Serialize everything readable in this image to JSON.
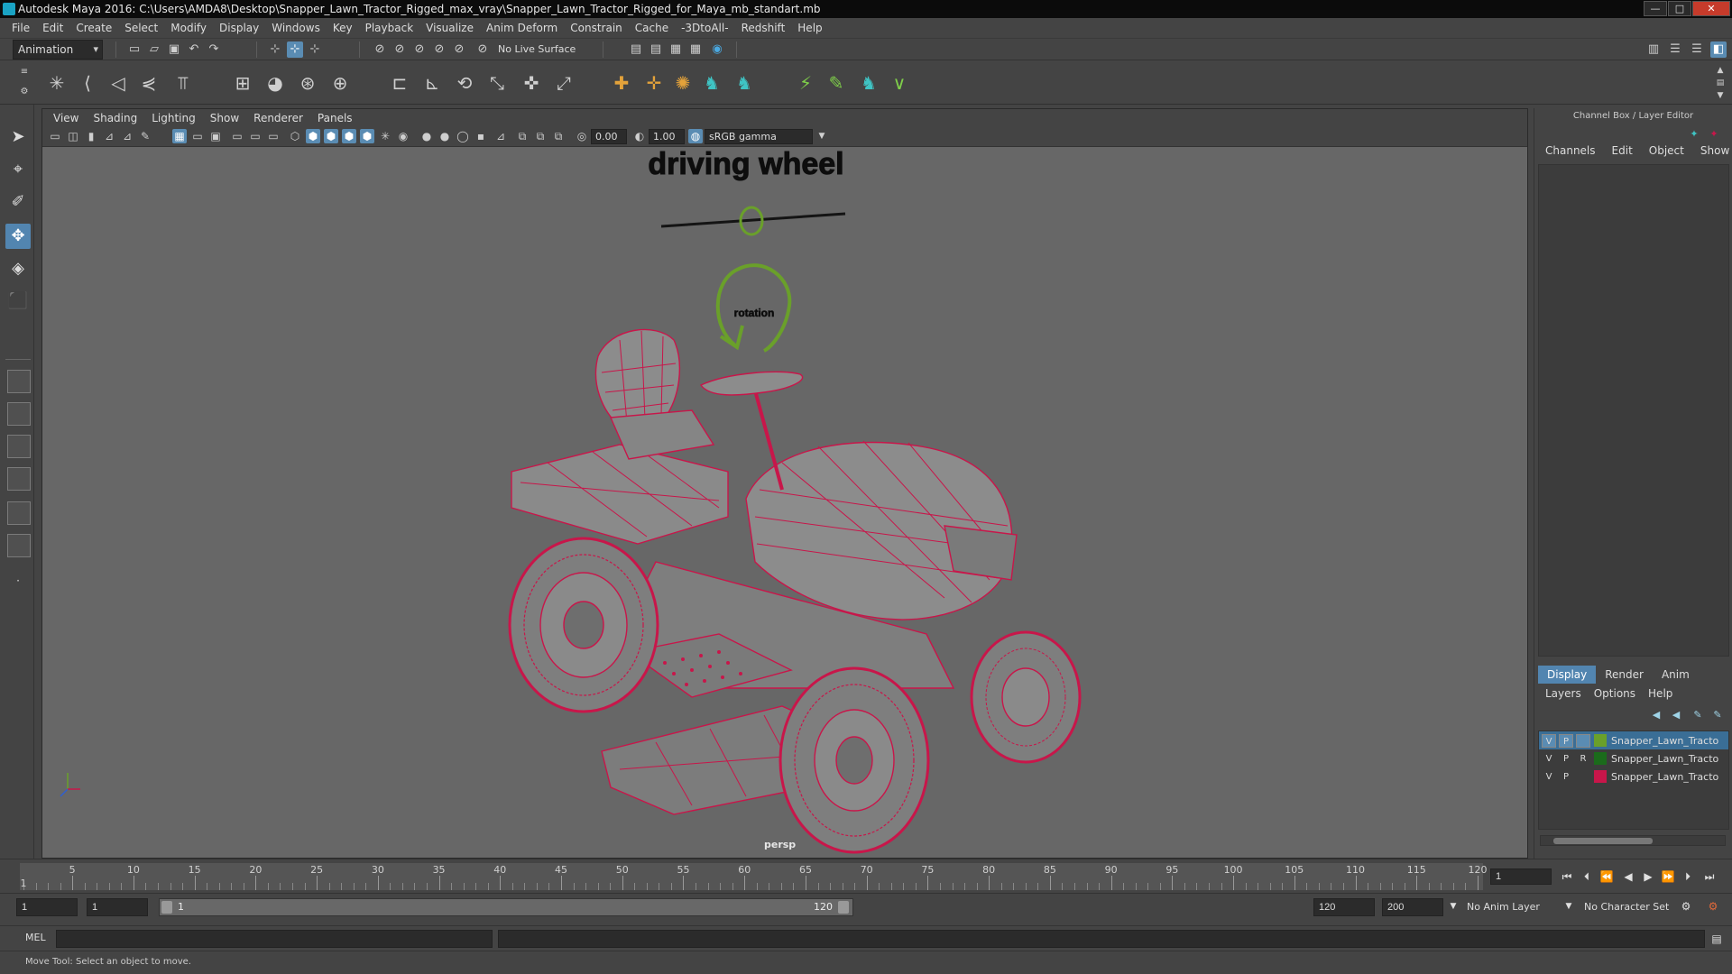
{
  "window": {
    "title": "Autodesk Maya 2016: C:\\Users\\AMDA8\\Desktop\\Snapper_Lawn_Tractor_Rigged_max_vray\\Snapper_Lawn_Tractor_Rigged_for_Maya_mb_standart.mb",
    "buttons": {
      "minimize": "—",
      "maximize": "□",
      "close": "✕"
    }
  },
  "menubar": [
    "File",
    "Edit",
    "Create",
    "Select",
    "Modify",
    "Display",
    "Windows",
    "Key",
    "Playback",
    "Visualize",
    "Anim Deform",
    "Constrain",
    "Cache",
    "-3DtoAll-",
    "Redshift",
    "Help"
  ],
  "statusline": {
    "mode": "Animation",
    "live_surface": "No Live Surface"
  },
  "viewport": {
    "menu": [
      "View",
      "Shading",
      "Lighting",
      "Show",
      "Renderer",
      "Panels"
    ],
    "exposure": "0.00",
    "gamma": "1.00",
    "color_space": "sRGB gamma",
    "camera": "persp",
    "controls": {
      "wheel_label": "driving wheel",
      "rotation_label": "rotation"
    },
    "wire_color": "#c8164a",
    "control_color": "#6aa02a"
  },
  "channel_box": {
    "title": "Channel Box / Layer Editor",
    "menu": [
      "Channels",
      "Edit",
      "Object",
      "Show"
    ],
    "layer_tabs": [
      "Display",
      "Render",
      "Anim"
    ],
    "active_tab": "Display",
    "layer_menu": [
      "Layers",
      "Options",
      "Help"
    ],
    "layers": [
      {
        "v": "V",
        "p": "P",
        "r": "",
        "color": "#6aa02a",
        "name": "Snapper_Lawn_Tractor",
        "selected": true
      },
      {
        "v": "V",
        "p": "P",
        "r": "R",
        "color": "#1b6b1b",
        "name": "Snapper_Lawn_Tractor",
        "selected": false
      },
      {
        "v": "V",
        "p": "P",
        "r": "",
        "color": "#c8164a",
        "name": "Snapper_Lawn_Tractor",
        "selected": false
      }
    ]
  },
  "timeline": {
    "start": 1,
    "end": 120,
    "ticks": [
      5,
      10,
      15,
      20,
      25,
      30,
      35,
      40,
      45,
      50,
      55,
      60,
      65,
      70,
      75,
      80,
      85,
      90,
      95,
      100,
      105,
      110,
      115,
      120
    ],
    "first_label": "1",
    "current_frame": "1"
  },
  "range": {
    "start_time": "1",
    "playback_start": "1",
    "range_start_label": "1",
    "range_end_label": "120",
    "playback_end": "120",
    "end_time": "200",
    "anim_layer": "No Anim Layer",
    "character_set": "No Character Set"
  },
  "command_line": {
    "language": "MEL"
  },
  "help_line": "Move Tool: Select an object to move."
}
